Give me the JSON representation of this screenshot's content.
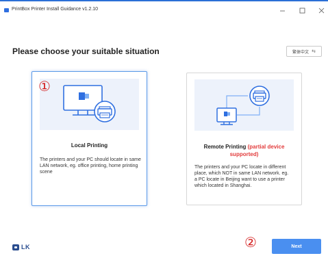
{
  "window": {
    "title": "PrintBox Printer Install Guidance v1.2.10",
    "minimize_glyph": "–",
    "maximize_glyph": "☐",
    "close_glyph": "✕"
  },
  "header": {
    "heading": "Please choose your suitable situation",
    "language_button": "繁体中文",
    "language_icon": "swap-icon"
  },
  "cards": {
    "local": {
      "title": "Local Printing",
      "description": "The printers and your PC should locate in same LAN network, eg. office printing, home printing scene",
      "selected": true
    },
    "remote": {
      "title": "Remote Printing",
      "title_note": "(partial device supported)",
      "description": "The printers and your PC locate in different place, which NOT in same LAN network. eg. a PC locate in Beijing want to use a printer which located in Shanghai."
    }
  },
  "annotations": {
    "badge_1": "①",
    "badge_2": "②"
  },
  "footer": {
    "logo_text": "LK",
    "next_button": "Next"
  },
  "colors": {
    "accent": "#4a8ff0",
    "selected_border": "#5b9ae8",
    "illustration_bg": "#edf2fb",
    "warning_red": "#e23b3b"
  }
}
